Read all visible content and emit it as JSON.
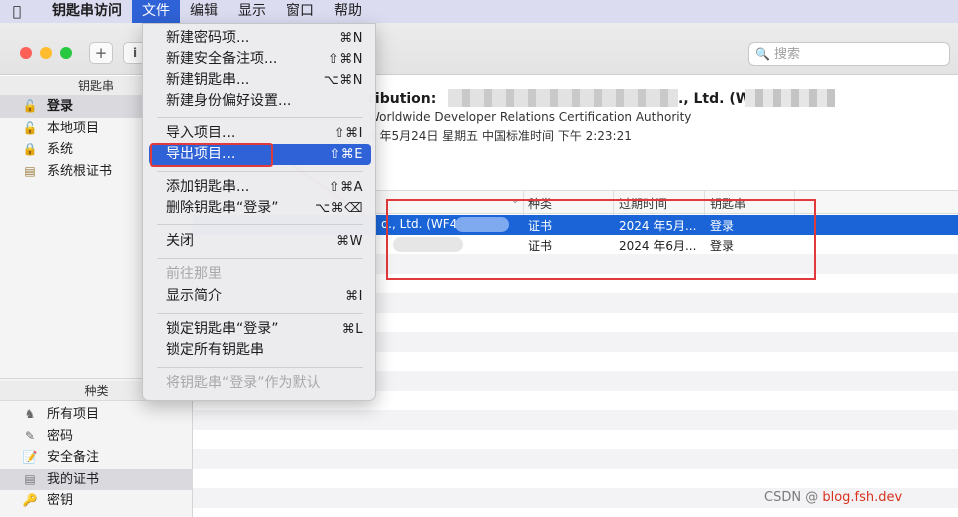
{
  "menubar": {
    "app_name": "钥匙串访问",
    "items": [
      "文件",
      "编辑",
      "显示",
      "窗口",
      "帮助"
    ]
  },
  "toolbar": {
    "add_label": "+",
    "info_label": "i",
    "search_placeholder": "搜索"
  },
  "sidebar": {
    "keychains_header": "钥匙串",
    "keychains": [
      {
        "label": "登录",
        "icon": "lock-open-icon",
        "selected": true
      },
      {
        "label": "本地项目",
        "icon": "lock-open-icon",
        "selected": false
      },
      {
        "label": "系统",
        "icon": "lock-icon",
        "selected": false
      },
      {
        "label": "系统根证书",
        "icon": "certificate-cabinet-icon",
        "selected": false
      }
    ],
    "kind_header": "种类",
    "kinds": [
      {
        "label": "所有项目",
        "icon": "all-items-icon",
        "selected": false
      },
      {
        "label": "密码",
        "icon": "pencil-icon",
        "selected": false
      },
      {
        "label": "安全备注",
        "icon": "note-icon",
        "selected": false
      },
      {
        "label": "我的证书",
        "icon": "certificate-icon",
        "selected": true
      },
      {
        "label": "密钥",
        "icon": "key-icon",
        "selected": false
      }
    ]
  },
  "detail": {
    "title_prefix": "ribution:",
    "title_suffix": "., Ltd. (W",
    "issuer": "Worldwide Developer Relations Certification Authority",
    "expiry": "4 年5月24日 星期五 中国标准时间 下午 2:23:21"
  },
  "table": {
    "columns": [
      "种类",
      "过期时间",
      "钥匙串"
    ],
    "rows": [
      {
        "name": "o., Ltd. (WF4",
        "kind": "证书",
        "expires": "2024 年5月...",
        "keychain": "登录",
        "selected": true
      },
      {
        "name": "",
        "kind": "证书",
        "expires": "2024 年6月...",
        "keychain": "登录",
        "selected": false
      }
    ]
  },
  "file_menu": {
    "items": [
      {
        "label": "新建密码项...",
        "shortcut": "⌘N",
        "disabled": false,
        "highlighted": false
      },
      {
        "label": "新建安全备注项...",
        "shortcut": "⇧⌘N",
        "disabled": false,
        "highlighted": false
      },
      {
        "label": "新建钥匙串...",
        "shortcut": "⌥⌘N",
        "disabled": false,
        "highlighted": false
      },
      {
        "label": "新建身份偏好设置...",
        "shortcut": "",
        "disabled": false,
        "highlighted": false
      },
      {
        "label": "导入项目...",
        "shortcut": "⇧⌘I",
        "disabled": false,
        "highlighted": false
      },
      {
        "label": "导出项目...",
        "shortcut": "⇧⌘E",
        "disabled": false,
        "highlighted": true
      },
      {
        "label": "添加钥匙串...",
        "shortcut": "⇧⌘A",
        "disabled": false,
        "highlighted": false
      },
      {
        "label": "删除钥匙串“登录”",
        "shortcut": "⌥⌘⌫",
        "disabled": false,
        "highlighted": false
      },
      {
        "label": "关闭",
        "shortcut": "⌘W",
        "disabled": false,
        "highlighted": false
      },
      {
        "label": "前往那里",
        "shortcut": "",
        "disabled": true,
        "highlighted": false
      },
      {
        "label": "显示简介",
        "shortcut": "⌘I",
        "disabled": false,
        "highlighted": false
      },
      {
        "label": "锁定钥匙串“登录”",
        "shortcut": "⌘L",
        "disabled": false,
        "highlighted": false
      },
      {
        "label": "锁定所有钥匙串",
        "shortcut": "",
        "disabled": false,
        "highlighted": false
      },
      {
        "label": "将钥匙串“登录”作为默认",
        "shortcut": "",
        "disabled": true,
        "highlighted": false
      }
    ]
  },
  "watermark": {
    "text": "CSDN @",
    "red_text": "blog.fsh.dev"
  },
  "colors": {
    "accent": "#2f62d6",
    "selection": "#1a64d8",
    "annotation": "#e23a3a"
  }
}
